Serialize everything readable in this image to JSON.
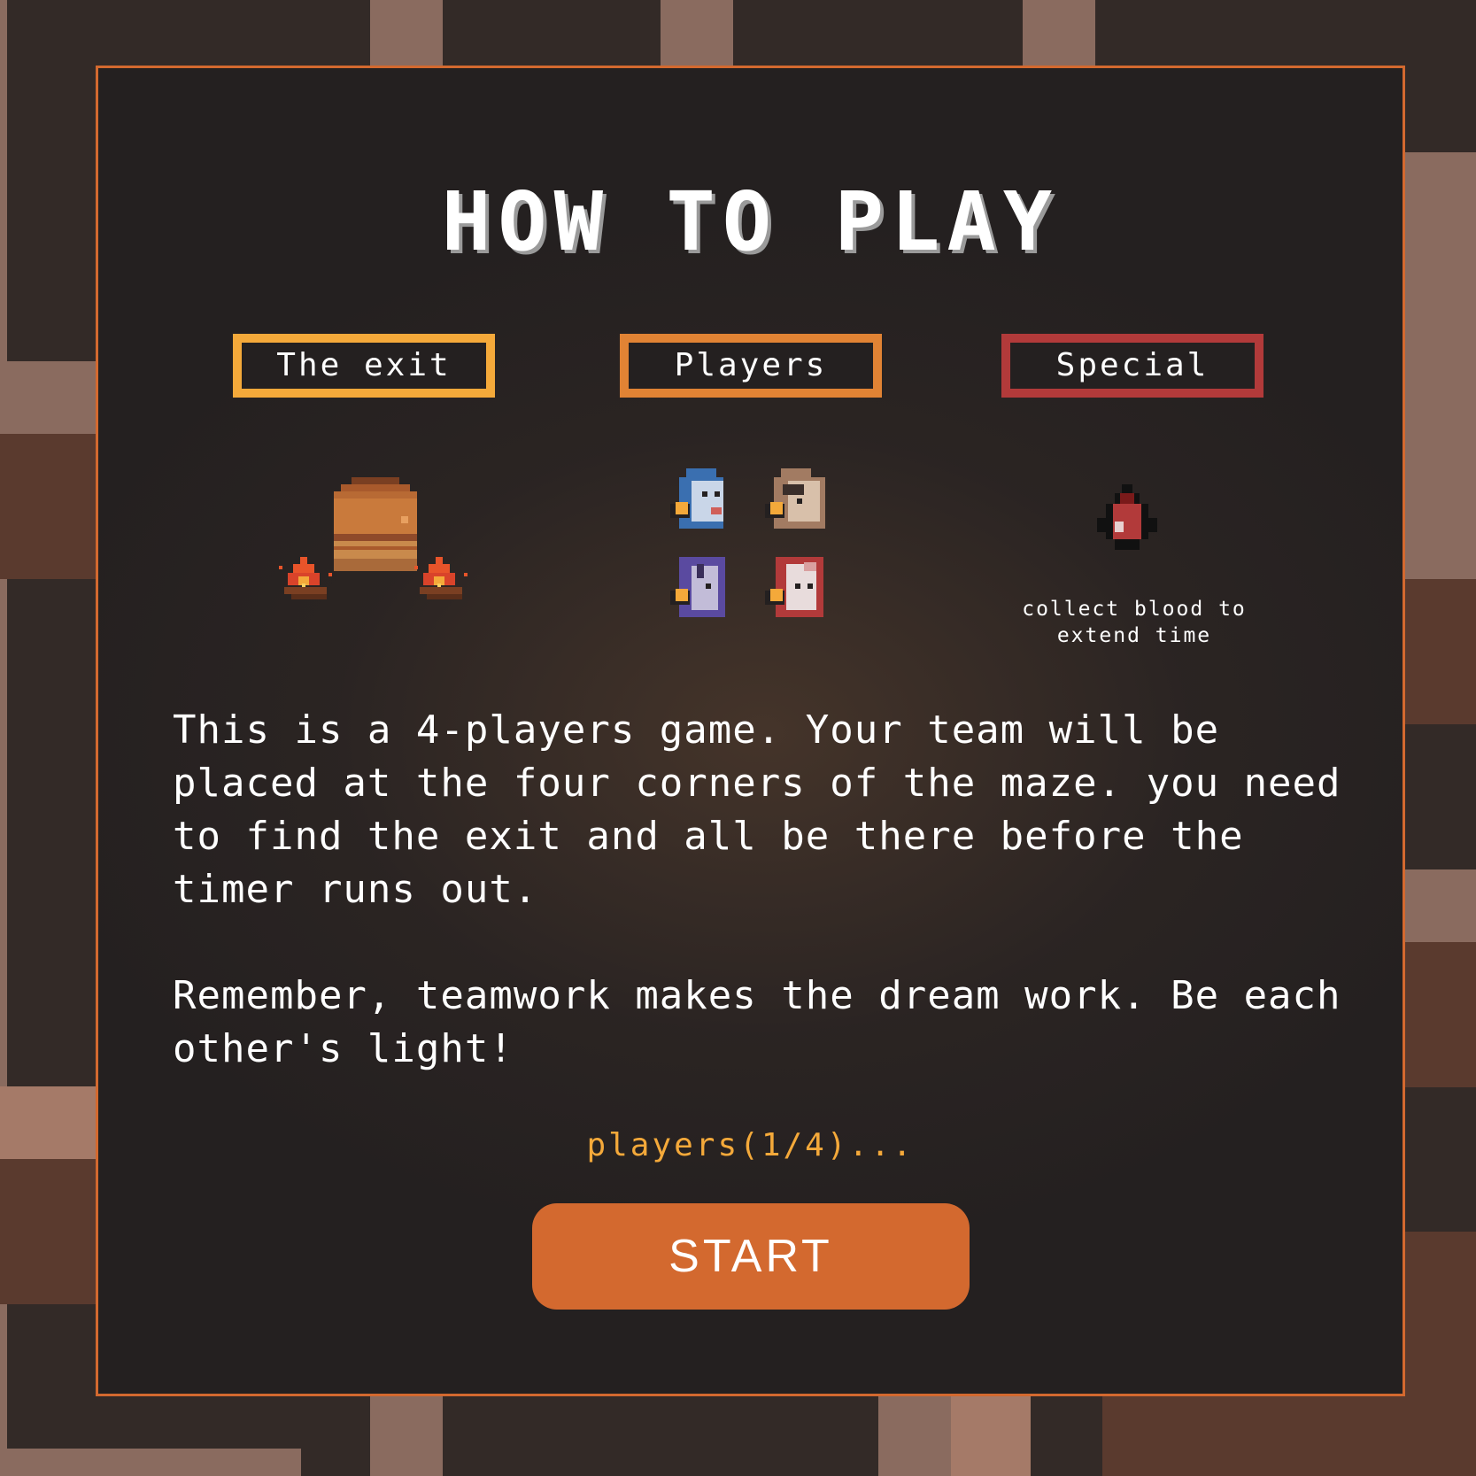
{
  "title": "HOW TO PLAY",
  "tabs": {
    "exit": "The exit",
    "players": "Players",
    "special": "Special"
  },
  "special_caption_line1": "collect blood to",
  "special_caption_line2": "extend time",
  "instructions": {
    "paragraph1": "This is a 4-players game. Your team will be placed at the four corners of the maze. you need to find the exit and all be there before the timer runs out.",
    "paragraph2": "Remember, teamwork makes the dream work. Be each other's light!"
  },
  "lobby_status": "players(1/4)...",
  "start_button": "START",
  "colors": {
    "accent_orange": "#d3692f",
    "exit_tab": "#f4a93a",
    "players_tab": "#e18334",
    "special_tab": "#b23a3a",
    "panel_bg": "#242020"
  },
  "icons": [
    "exit-door-icon",
    "campfire-icon",
    "player-blue-icon",
    "player-tan-icon",
    "player-purple-icon",
    "player-red-icon",
    "blood-drop-icon"
  ]
}
